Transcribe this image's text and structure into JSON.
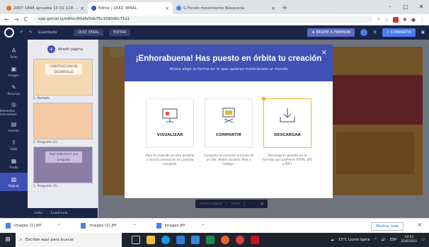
{
  "browser": {
    "tabs": [
      {
        "label": "2007 1894 aprueba 10 01 118 ...",
        "color": "#e37400",
        "active": false
      },
      {
        "label": "Editor | QUIZ 3ERAL",
        "color": "#3f51b5",
        "active": true
      },
      {
        "label": "G  Fondo movimiento  Búsqueda",
        "color": "#4285f4",
        "active": false
      }
    ],
    "new_tab": "+",
    "url": "app.genial.ly/editor/60afe5eb75c1560d0c71a1",
    "window_controls": {
      "min": "–",
      "max": "□",
      "close": "✕"
    }
  },
  "editor": {
    "crumb_home": "Guardado",
    "title_chip": "QUIZ 3ERAL",
    "mode_chip": "EDITAR",
    "premium_label": "★ PÁSATE A PREMIUM",
    "share_label": "< COMPARTIR"
  },
  "rail": [
    {
      "label": "Texto",
      "icon": "A"
    },
    {
      "label": "Imagen",
      "icon": "▣"
    },
    {
      "label": "Recursos",
      "icon": "✎"
    },
    {
      "label": "Elementos interactivos",
      "icon": "◎"
    },
    {
      "label": "Insertar",
      "icon": "▤"
    },
    {
      "label": "Subir",
      "icon": "⇪"
    },
    {
      "label": "Fondo",
      "icon": "▦"
    },
    {
      "label": "Páginas",
      "icon": "▥"
    }
  ],
  "pages": {
    "add_label": "Añadir página",
    "items": [
      {
        "label": "1. Portada",
        "thumb_text": "CONSTRUCCIÓN DE DESARROLLO"
      },
      {
        "label": "2. Pregunta (1)",
        "thumb_text": ""
      },
      {
        "label": "3. Pregunta (2)",
        "thumb_text": "Aquí debe tener una pregunta"
      }
    ],
    "footer": [
      "Lista",
      "Cuadrícula"
    ]
  },
  "bottom_tools": [
    "Añadir página",
    "100%"
  ],
  "modal": {
    "title": "¡Enhorabuena! Has puesto en órbita tu creación",
    "subtitle": "Ahora elige la forma en la que quieres mostrárselo al mundo",
    "options": [
      {
        "label": "VISUALIZAR",
        "icon": "presentation-icon",
        "desc": "Abre tu creación en otra pestaña y mira tu animación en pantalla completa."
      },
      {
        "label": "COMPARTIR",
        "icon": "share-screen-icon",
        "desc": "Comparte tu creación a través de un link. Redes sociales, Mail o Códigos."
      },
      {
        "label": "DESCARGAR",
        "icon": "download-icon",
        "desc": "Descarga tu genially en el formato que prefieras (HTML, JPG o PDF)."
      }
    ]
  },
  "downloads": {
    "items": [
      "images (1).jfif",
      "images (2).jfif",
      "images.jfif"
    ],
    "show_all": "Mostrar todo"
  },
  "taskbar": {
    "search_placeholder": "Escribe aquí para buscar",
    "weather": "15°C  Lluvia ligera",
    "lang": "ESP",
    "time": "18:02",
    "date": "25/6/2021"
  }
}
